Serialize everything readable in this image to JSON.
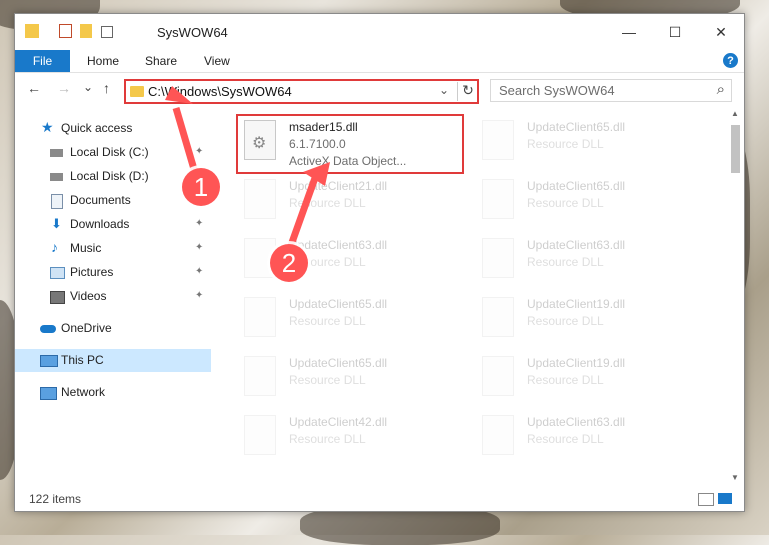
{
  "window": {
    "title": "SysWOW64",
    "min": "—",
    "max": "☐",
    "close": "✕"
  },
  "ribbon": {
    "file": "File",
    "tabs": [
      "Home",
      "Share",
      "View"
    ],
    "help": "?"
  },
  "nav": {
    "back": "←",
    "forward": "→",
    "recent": "⌄",
    "up": "↑",
    "address": "C:\\Windows\\SysWOW64",
    "address_dropdown": "⌄",
    "refresh": "↻",
    "search_placeholder": "Search SysWOW64",
    "search_icon": "⌕"
  },
  "sidebar": {
    "items": [
      {
        "label": "Quick access",
        "icon": "star-icon",
        "pinned": false
      },
      {
        "label": "Local Disk (C:)",
        "icon": "drive-icon",
        "pinned": true
      },
      {
        "label": "Local Disk (D:)",
        "icon": "drive-icon",
        "pinned": false
      },
      {
        "label": "Documents",
        "icon": "document-icon",
        "pinned": true
      },
      {
        "label": "Downloads",
        "icon": "download-icon",
        "pinned": true
      },
      {
        "label": "Music",
        "icon": "music-icon",
        "pinned": true
      },
      {
        "label": "Pictures",
        "icon": "picture-icon",
        "pinned": true
      },
      {
        "label": "Videos",
        "icon": "video-icon",
        "pinned": true
      },
      {
        "label": "OneDrive",
        "icon": "cloud-icon",
        "pinned": false
      },
      {
        "label": "This PC",
        "icon": "computer-icon",
        "pinned": false,
        "selected": true
      },
      {
        "label": "Network",
        "icon": "network-icon",
        "pinned": false
      }
    ],
    "pin_glyph": "📌"
  },
  "files": [
    {
      "name": "msader15.dll",
      "version": "6.1.7100.0",
      "desc": "ActiveX Data Object...",
      "faded": false
    },
    {
      "name": "UpdateClient65.dll",
      "desc": "Resource DLL",
      "faded": true
    },
    {
      "name": "UpdateClient21.dll",
      "desc": "Resource DLL",
      "faded": true
    },
    {
      "name": "UpdateClient65.dll",
      "desc": "Resource DLL",
      "faded": true
    },
    {
      "name": "UpdateClient63.dll",
      "desc": "Resource DLL",
      "faded": true
    },
    {
      "name": "UpdateClient63.dll",
      "desc": "Resource DLL",
      "faded": true
    },
    {
      "name": "UpdateClient65.dll",
      "desc": "Resource DLL",
      "faded": true
    },
    {
      "name": "UpdateClient19.dll",
      "desc": "Resource DLL",
      "faded": true
    },
    {
      "name": "UpdateClient65.dll",
      "desc": "Resource DLL",
      "faded": true
    },
    {
      "name": "UpdateClient19.dll",
      "desc": "Resource DLL",
      "faded": true
    },
    {
      "name": "UpdateClient42.dll",
      "desc": "Resource DLL",
      "faded": true
    },
    {
      "name": "UpdateClient63.dll",
      "desc": "Resource DLL",
      "faded": true
    }
  ],
  "status": {
    "count": "122 items"
  },
  "callouts": [
    "1",
    "2"
  ],
  "colors": {
    "accent": "#1979ca",
    "highlight": "#e03a3a",
    "callout": "#ff5555",
    "selection": "#cce8ff"
  }
}
